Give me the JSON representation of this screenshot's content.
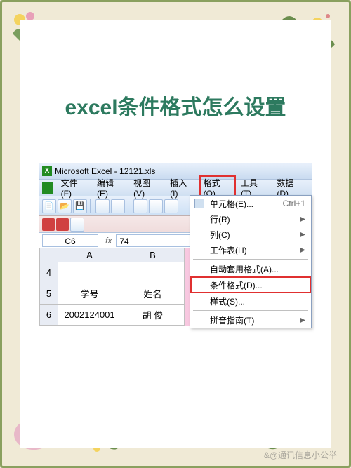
{
  "page_title": "excel条件格式怎么设置",
  "watermark": "&@通讯信息小公举",
  "excel": {
    "window_title": "Microsoft Excel - 12121.xls",
    "menu": {
      "file": "文件(F)",
      "edit": "编辑(E)",
      "view": "视图(V)",
      "insert": "插入(I)",
      "format": "格式(O)",
      "tools": "工具(T)",
      "data": "数据(D)"
    },
    "namebox": "C6",
    "formula": "74",
    "columns": {
      "a": "A",
      "b": "B"
    },
    "rows": {
      "r4": "4",
      "r5": "5",
      "r6": "6"
    },
    "cells": {
      "a5": "学号",
      "b5": "姓名",
      "a6": "2002124001",
      "b6": "胡 俊"
    },
    "dropdown": {
      "cells": "单元格(E)...",
      "cells_shortcut": "Ctrl+1",
      "row": "行(R)",
      "column": "列(C)",
      "sheet": "工作表(H)",
      "autoformat": "自动套用格式(A)...",
      "conditional": "条件格式(D)...",
      "style": "样式(S)...",
      "phonetic": "拼音指南(T)"
    }
  }
}
